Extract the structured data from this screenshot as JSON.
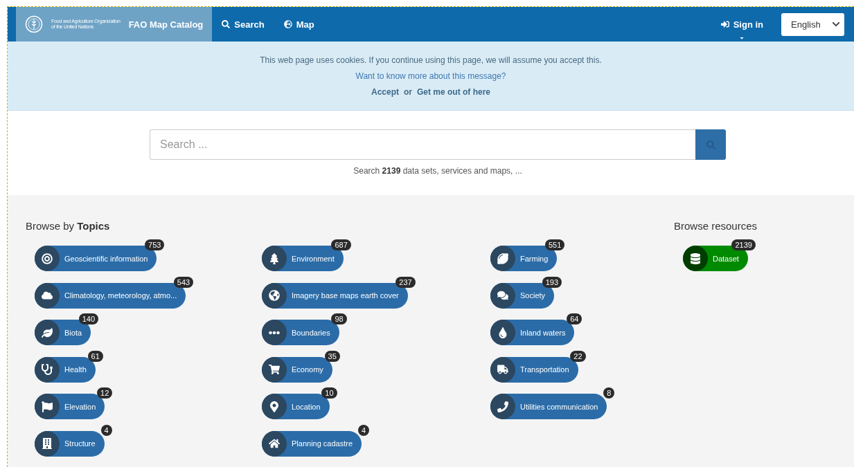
{
  "navbar": {
    "logo_text": [
      "Food and Agriculture Organization",
      "of the United Nations"
    ],
    "brand": "FAO Map Catalog",
    "links": [
      {
        "label": "Search"
      },
      {
        "label": "Map"
      }
    ],
    "sign_in": "Sign in",
    "language": "English"
  },
  "cookie_notice": {
    "message": "This web page uses cookies. If you continue using this page, we will assume you accept this.",
    "more_link": "Want to know more about this message?",
    "accept": "Accept",
    "or": "or",
    "decline": "Get me out of here"
  },
  "search": {
    "placeholder": "Search ...",
    "hint": "Search **2139** data sets, services and maps, ..."
  },
  "topics": {
    "heading": "Browse by **Topics**",
    "columns": [
      [
        {
          "label": "Geoscientific information",
          "count": "753"
        },
        {
          "label": "Climatology, meteorology, atmo...",
          "count": "543"
        },
        {
          "label": "Biota",
          "count": "140"
        },
        {
          "label": "Health",
          "count": "61"
        },
        {
          "label": "Elevation",
          "count": "12"
        },
        {
          "label": "Structure",
          "count": "4"
        }
      ],
      [
        {
          "label": "Environment",
          "count": "687"
        },
        {
          "label": "Imagery base maps earth cover",
          "count": "237"
        },
        {
          "label": "Boundaries",
          "count": "98"
        },
        {
          "label": "Economy",
          "count": "35"
        },
        {
          "label": "Location",
          "count": "10"
        },
        {
          "label": "Planning cadastre",
          "count": "4"
        }
      ],
      [
        {
          "label": "Farming",
          "count": "551"
        },
        {
          "label": "Society",
          "count": "193"
        },
        {
          "label": "Inland waters",
          "count": "64"
        },
        {
          "label": "Transportation",
          "count": "22"
        },
        {
          "label": "Utilities communication",
          "count": "8"
        }
      ]
    ]
  },
  "resources": {
    "heading": "Browse resources",
    "items": [
      {
        "label": "Dataset",
        "count": "2139",
        "color": "#008a00"
      }
    ]
  }
}
